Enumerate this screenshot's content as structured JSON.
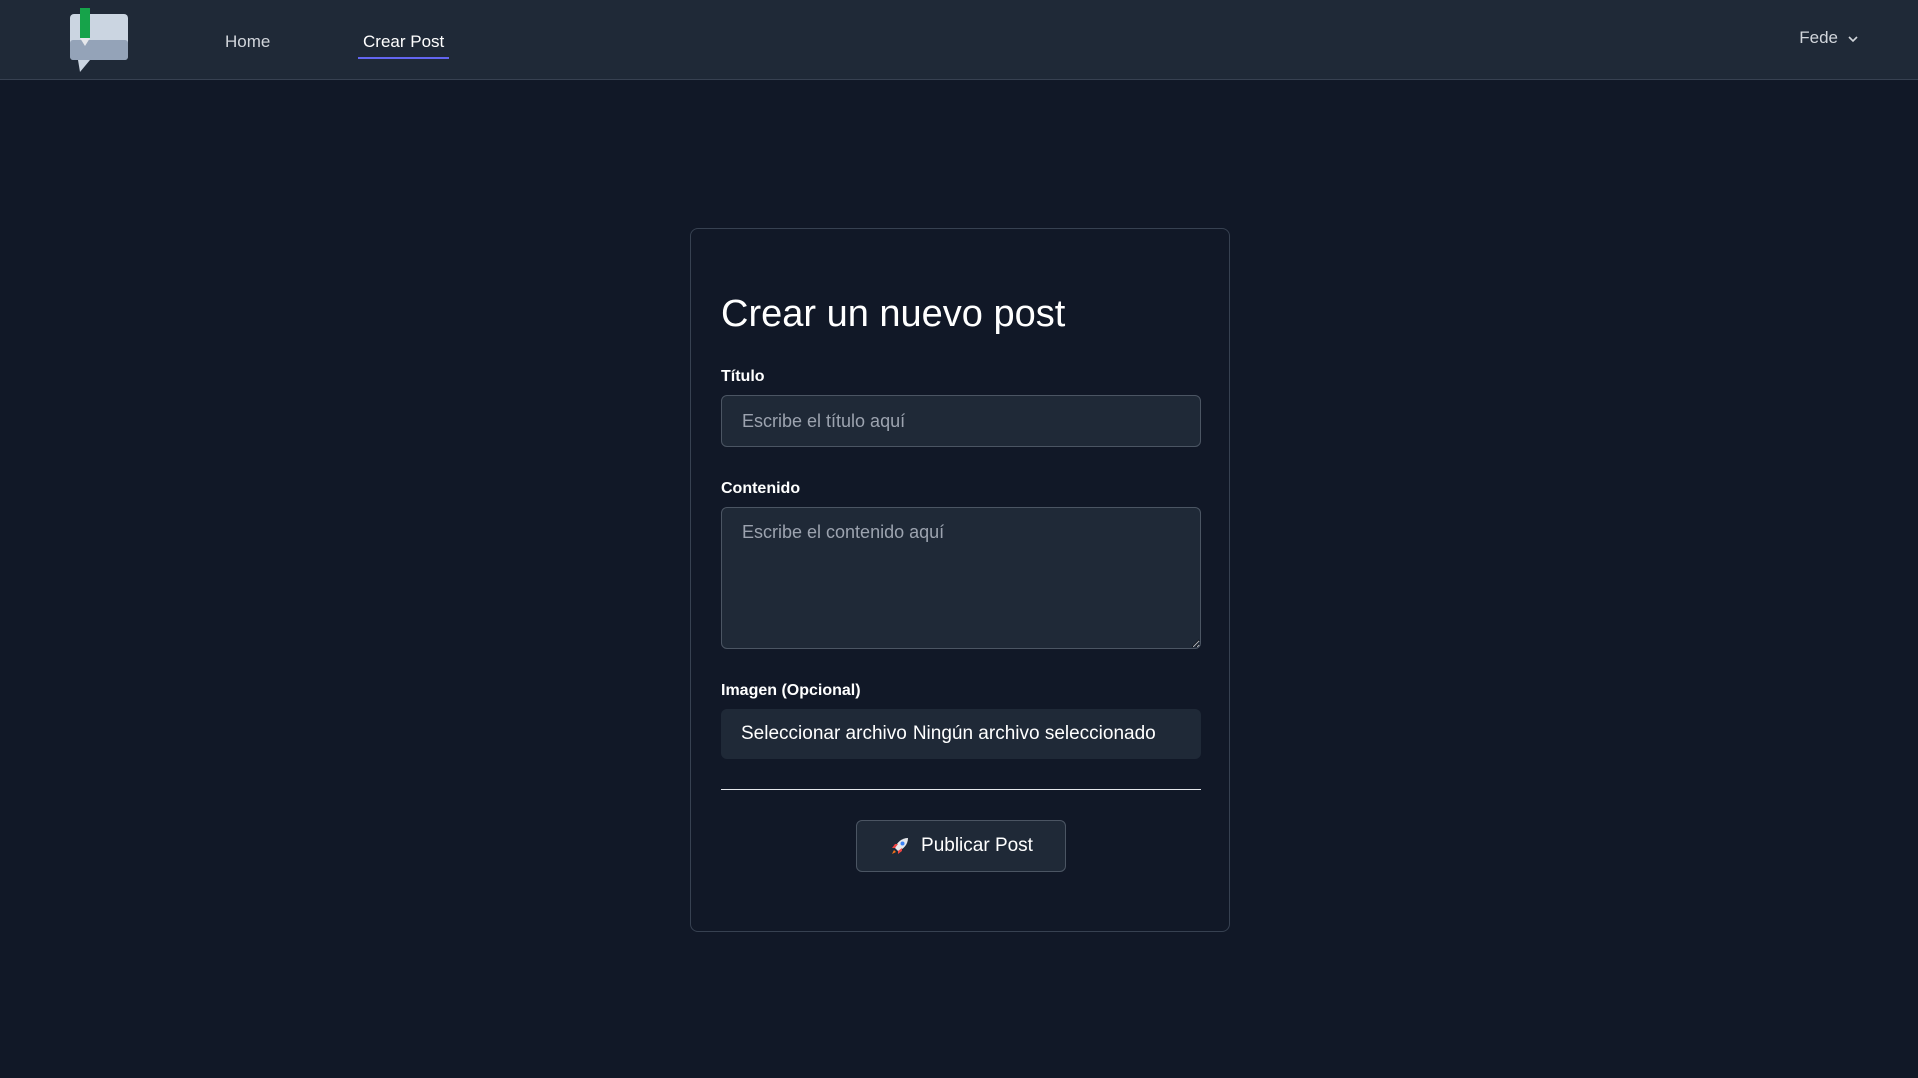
{
  "nav": {
    "logo_name": "app-logo-icon",
    "links": [
      {
        "label": "Home",
        "active": false
      },
      {
        "label": "Crear Post",
        "active": true
      }
    ],
    "user": {
      "name": "Fede",
      "icon": "chevron-down-icon"
    },
    "accent_color": "#6366f1"
  },
  "form": {
    "title": "Crear un nuevo post",
    "fields": {
      "title": {
        "label": "Título",
        "placeholder": "Escribe el título aquí",
        "value": ""
      },
      "content": {
        "label": "Contenido",
        "placeholder": "Escribe el contenido aquí",
        "value": ""
      },
      "image": {
        "label": "Imagen (Opcional)",
        "button_label": "Seleccionar archivo",
        "status": "Ningún archivo seleccionado"
      }
    },
    "submit": {
      "label": "Publicar Post",
      "icon": "rocket-icon"
    }
  }
}
